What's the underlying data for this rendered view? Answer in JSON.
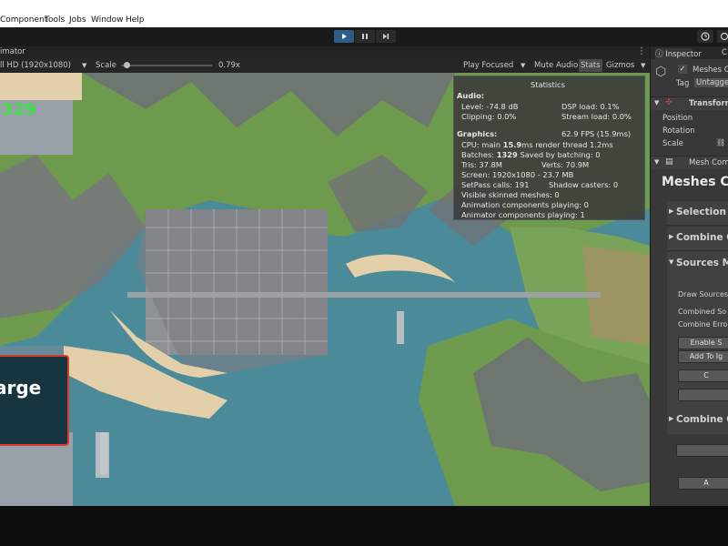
{
  "menubar": {
    "items": [
      "Component",
      "Tools",
      "Jobs",
      "Window",
      "Help"
    ]
  },
  "toolbar": {
    "play_icon": "play-icon",
    "pause_icon": "pause-icon",
    "step_icon": "step-icon",
    "history_icon": "history-icon",
    "cloud_icon": "cloud-icon"
  },
  "game_view": {
    "tab_label": "imator",
    "resolution": "ll HD (1920x1080)",
    "scale_label": "Scale",
    "scale_value": "0.79x",
    "scale_fraction": 0.06,
    "play_focused": "Play Focused",
    "mute_audio": "Mute Audio",
    "stats": "Stats",
    "gizmos": "Gizmos"
  },
  "stats_panel": {
    "title": "Statistics",
    "audio_header": "Audio:",
    "level": "Level: -74.8 dB",
    "clipping": "Clipping: 0.0%",
    "dsp_load": "DSP load: 0.1%",
    "stream_load": "Stream load: 0.0%",
    "graphics_header": "Graphics:",
    "fps": "62.9 FPS (15.9ms)",
    "cpu_prefix": "CPU: main ",
    "cpu_main": "15.9",
    "cpu_suffix": "ms  render thread 1.2ms",
    "batches_prefix": "Batches: ",
    "batches": "1329",
    "batches_suffix": "  Saved by batching: 0",
    "tris": "Tris: 37.8M",
    "verts": "Verts: 70.9M",
    "screen": "Screen: 1920x1080 - 23.7 MB",
    "setpass": "SetPass calls: 191",
    "shadow_casters": "Shadow casters: 0",
    "skinned": "Visible skinned meshes: 0",
    "anim_components": "Animation components playing: 0",
    "animator_components": "Animator components playing: 1"
  },
  "hud": {
    "counter": "329",
    "panel_label": "arge"
  },
  "inspector": {
    "tab_inspector": "Inspector",
    "tab_other": "C",
    "object_name": "Meshes C",
    "tag_label": "Tag",
    "tag_value": "Untagge",
    "transform_header": "Transform",
    "position": "Position",
    "rotation": "Rotation",
    "scale": "Scale",
    "mesh_comp_header": "Mesh Com",
    "meshes_co_title": "Meshes Co",
    "selection_t": "Selection T",
    "combine_op": "Combine Op",
    "sources_ma": "Sources Ma",
    "draw_sources": "Draw Sources",
    "combined_so": "Combined So",
    "combine_error": "Combine Erro",
    "enable_s": "Enable S",
    "add_to_ig": "Add To Ig",
    "btn_c": "C",
    "combine_ou": "Combine Ou",
    "btn_a": "A"
  },
  "colors": {
    "water": "#4b8a98",
    "land": "#6e9a4e",
    "mountain": "#6f7077",
    "beach": "#e3cfa9",
    "accent_play": "#2c5d87",
    "hud_green": "#3fe04a",
    "hud_border": "#d93a2a"
  }
}
